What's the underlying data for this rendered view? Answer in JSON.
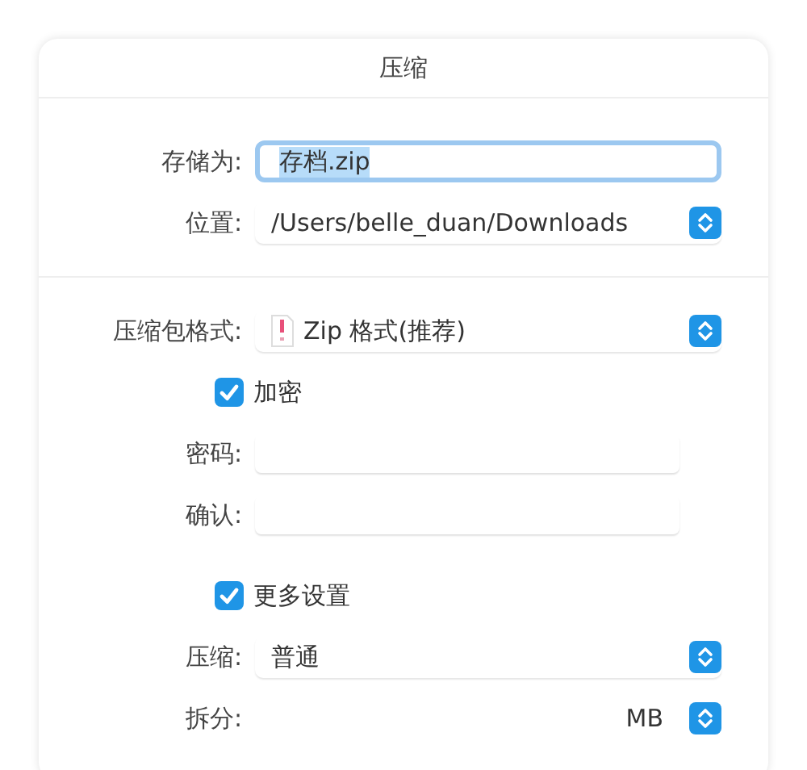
{
  "dialog": {
    "title": "压缩"
  },
  "sections": [
    {
      "rows": [
        {
          "kind": "text",
          "label": "存储为:",
          "value": "存档.zip",
          "focused": true
        },
        {
          "kind": "popup",
          "label": "位置:",
          "value": "/Users/belle_duan/Downloads"
        }
      ]
    },
    {
      "rows": [
        {
          "kind": "popup",
          "label": "压缩包格式:",
          "value": "Zip 格式(推荐)",
          "file_icon": true
        },
        {
          "kind": "checkbox",
          "label": "加密",
          "checked": true
        },
        {
          "kind": "secure",
          "label": "密码:"
        },
        {
          "kind": "secure",
          "label": "确认:"
        }
      ]
    },
    {
      "rows": [
        {
          "kind": "checkbox",
          "label": "更多设置",
          "checked": true
        },
        {
          "kind": "popup",
          "label": "压缩:",
          "value": "普通"
        },
        {
          "kind": "split",
          "label": "拆分:",
          "unit": "MB"
        }
      ]
    }
  ]
}
